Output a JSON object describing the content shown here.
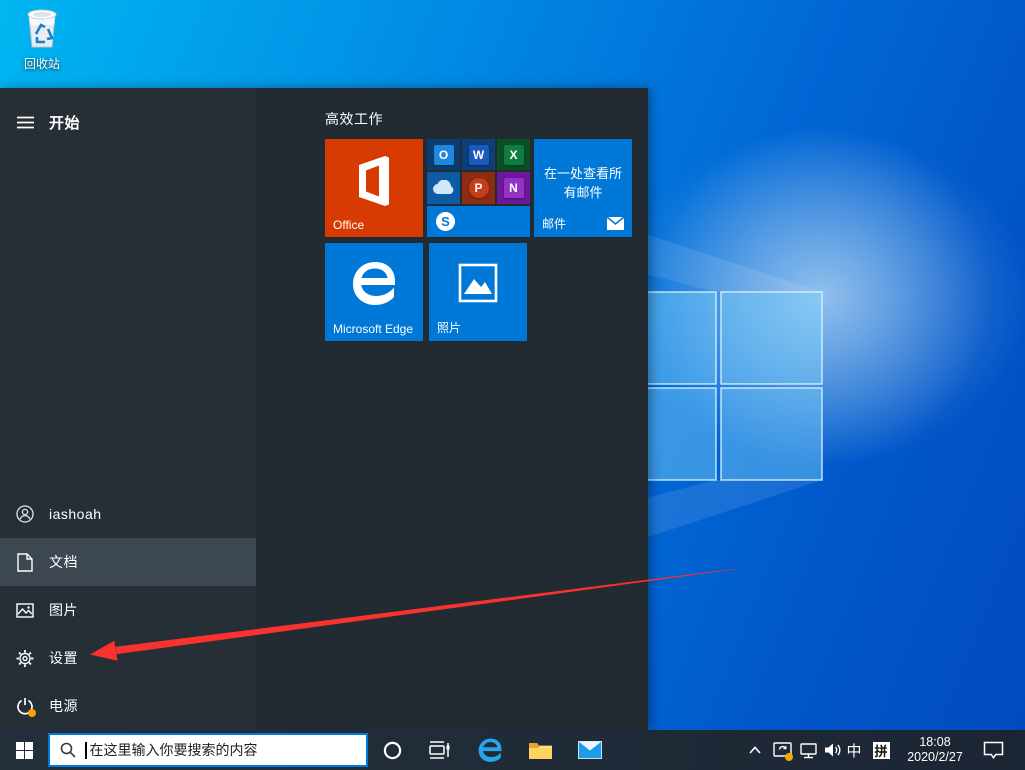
{
  "desktop": {
    "recycle_bin_label": "回收站"
  },
  "start_menu": {
    "menu_title": "开始",
    "section_title": "高效工作",
    "tiles": {
      "office_label": "Office",
      "mail_headline": "在一处查看所有邮件",
      "mail_label": "邮件",
      "edge_label": "Microsoft Edge",
      "photos_label": "照片"
    },
    "office_group": {
      "apps": [
        {
          "name": "Outlook",
          "letter": "O"
        },
        {
          "name": "Word",
          "letter": "W"
        },
        {
          "name": "Excel",
          "letter": "X"
        },
        {
          "name": "OneDrive",
          "icon": "cloud-icon"
        },
        {
          "name": "PowerPoint",
          "letter": "P"
        },
        {
          "name": "OneNote",
          "letter": "N"
        },
        {
          "name": "Skype",
          "letter": "S"
        }
      ]
    },
    "sidebar": {
      "user": "iashoah",
      "documents": "文档",
      "pictures": "图片",
      "settings": "设置",
      "power": "电源"
    }
  },
  "taskbar": {
    "search_placeholder": "在这里输入你要搜索的内容",
    "tray": {
      "ime_mode": "中",
      "ime_pinyin": "拼",
      "time": "18:08",
      "date": "2020/2/27"
    }
  },
  "colors": {
    "accent_blue": "#0078d7",
    "office_orange": "#d83b01",
    "excel_green": "#107c41",
    "powerpoint_red": "#c43e1c",
    "onenote_purple": "#9332c4",
    "word_blue": "#185abd",
    "arrow_red": "#f8322e",
    "taskbar_bg": "#202b38",
    "start_menu_bg": "#222a32",
    "update_badge_orange": "#f7a500"
  }
}
